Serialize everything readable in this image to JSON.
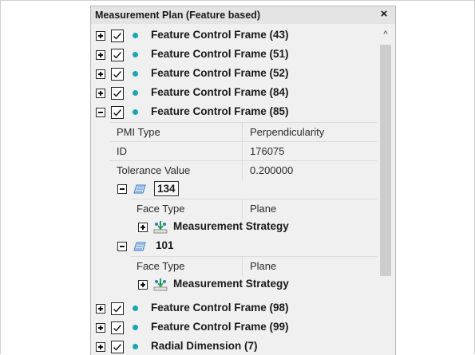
{
  "panel": {
    "title": "Measurement Plan (Feature based)",
    "close_glyph": "×"
  },
  "tree": {
    "fcf_43": "Feature Control Frame (43)",
    "fcf_51": "Feature Control Frame (51)",
    "fcf_52": "Feature Control Frame (52)",
    "fcf_84": "Feature Control Frame (84)",
    "fcf_85": "Feature Control Frame (85)",
    "fcf_85_props": {
      "pmi_type_key": "PMI Type",
      "pmi_type_val": "Perpendicularity",
      "id_key": "ID",
      "id_val": "176075",
      "tol_key": "Tolerance Value",
      "tol_val": "0.200000"
    },
    "face_134": {
      "label": "134",
      "face_type_key": "Face Type",
      "face_type_val": "Plane",
      "strategy": "Measurement Strategy"
    },
    "face_101": {
      "label": "101",
      "face_type_key": "Face Type",
      "face_type_val": "Plane",
      "strategy": "Measurement Strategy"
    },
    "fcf_98": "Feature Control Frame (98)",
    "fcf_99": "Feature Control Frame (99)",
    "radial_7": "Radial Dimension (7)"
  },
  "scrollbar": {
    "up_glyph": "^"
  },
  "colors": {
    "feature_dot": "#1aa5b5",
    "panel_bg": "#f0f0f0",
    "thumb": "#cdcdcd"
  },
  "icons": [
    "plus-expander-icon",
    "minus-expander-icon",
    "checkbox-checked-icon",
    "feature-dot-icon",
    "face-icon",
    "measurement-strategy-icon",
    "close-icon",
    "scroll-up-icon"
  ]
}
